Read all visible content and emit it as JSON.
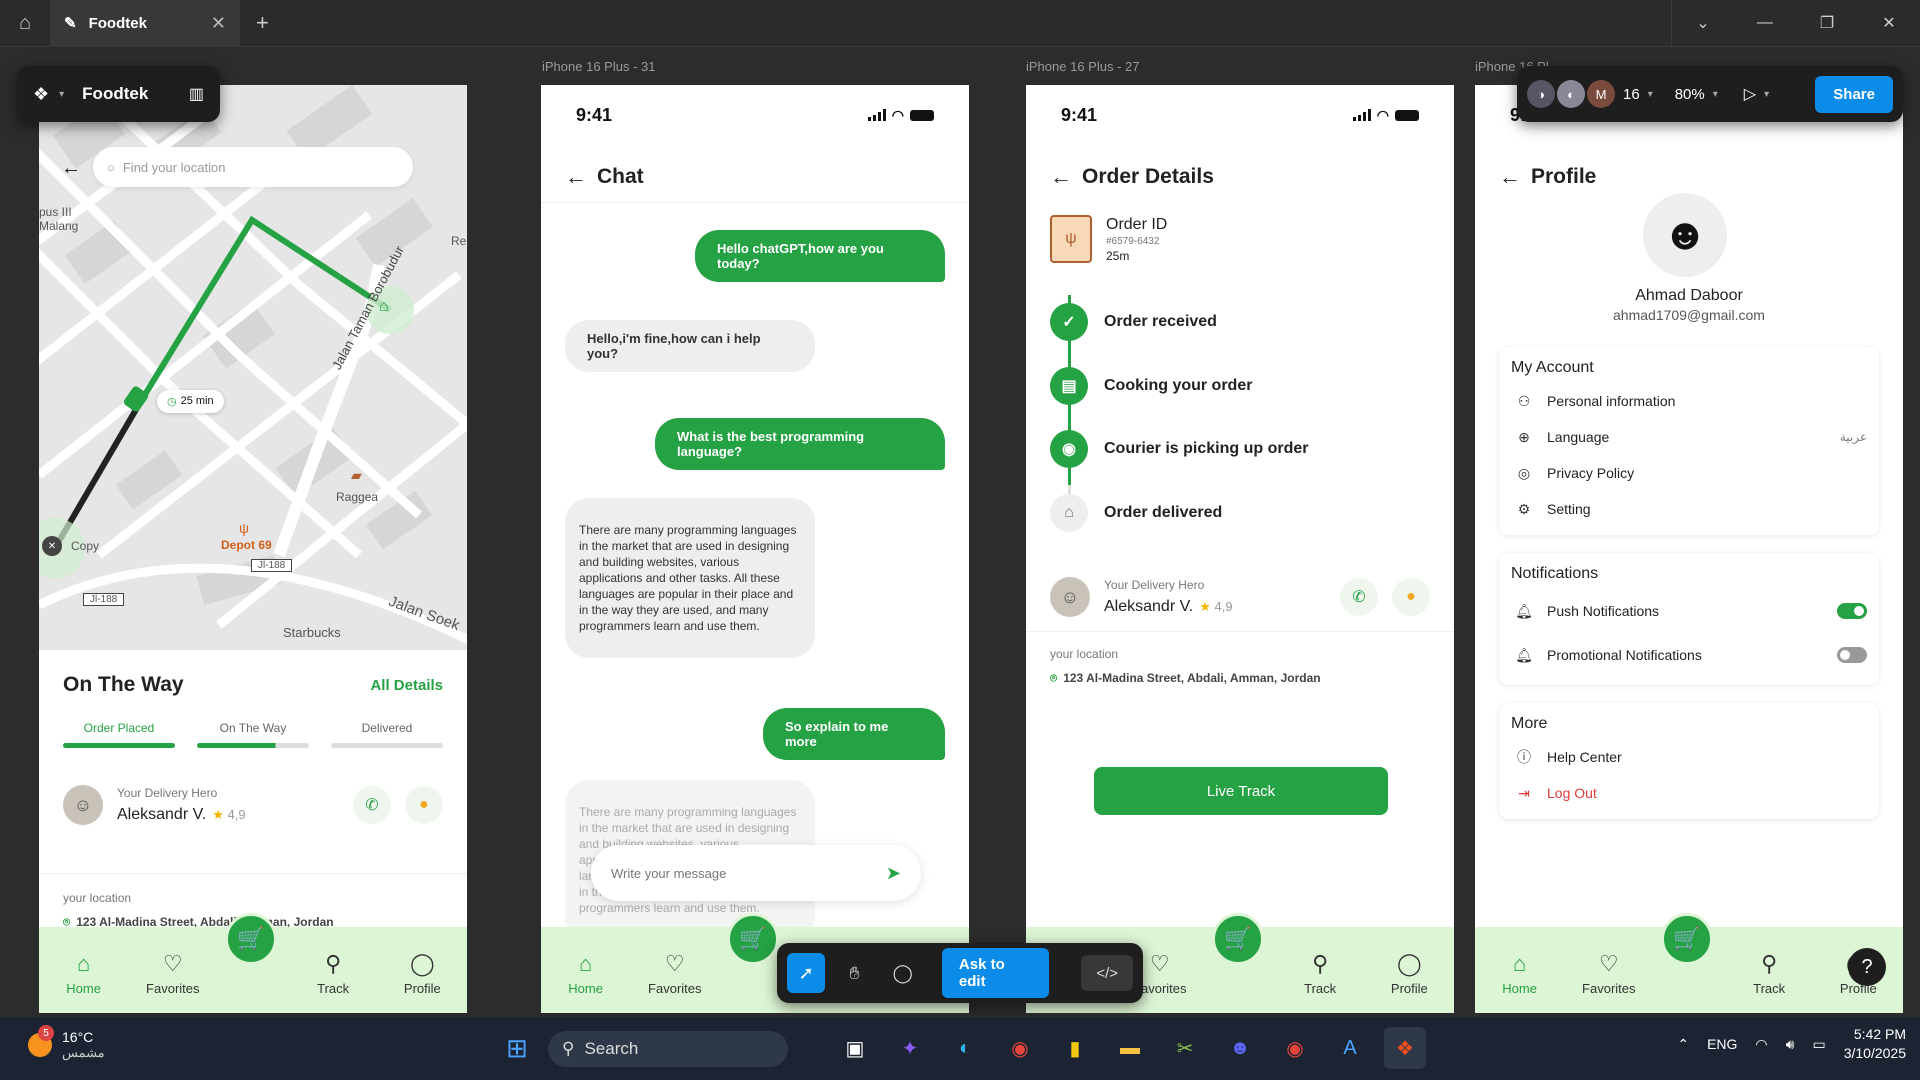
{
  "titlebar": {
    "tab_title": "Foodtek"
  },
  "figma": {
    "file_name": "Foodtek",
    "collaborator_initial": "M",
    "collaborator_count": "16",
    "zoom": "80%",
    "share_label": "Share",
    "ask_label": "Ask to edit",
    "help_label": "?"
  },
  "frames": {
    "f1": "iPhone 16 Plus - 31",
    "f2": "iPhone 16 Plus - 27",
    "f3": "iPhone 16 Pl"
  },
  "status_time": "9:41",
  "nav": {
    "home": "Home",
    "favorites": "Favorites",
    "track": "Track",
    "profile": "Profile"
  },
  "track_screen": {
    "search_placeholder": "Find your location",
    "map_labels": {
      "malang": "pus III\nMalang",
      "re": "Re",
      "eta": "25 min",
      "street": "Jalan Taman Borobudur",
      "raggea": "Raggea",
      "copy": "Copy",
      "depot": "Depot 69",
      "jl1": "Jl-188",
      "jl2": "Jl-188",
      "starbucks": "Starbucks",
      "soek": "Jalan Soek"
    },
    "title": "On The Way",
    "all_details": "All Details",
    "steps": [
      "Order Placed",
      "On The Way",
      "Delivered"
    ],
    "hero_label": "Your Delivery Hero",
    "hero_name": "Aleksandr V.",
    "rating": "4,9",
    "location_label": "your location",
    "address": "123 Al-Madina Street, Abdali, Amman, Jordan"
  },
  "chat_screen": {
    "title": "Chat",
    "messages": [
      "Hello chatGPT,how are you today?",
      "Hello,i'm fine,how can i help you?",
      "What is the best programming language?",
      "There are many programming languages in the market that are used in designing and building websites, various applications and other tasks. All these languages are popular in their place and in the way they are used, and many programmers learn and use them.",
      "So explain to me more",
      "There are many programming languages in the market that are used in designing and building websites, various applications and other tasks. All these languages are popular in their place and in the way they are used, and many programmers learn and use them."
    ],
    "input_placeholder": "Write your message"
  },
  "order_screen": {
    "title": "Order Details",
    "order_id_label": "Order ID",
    "order_id": "#6579-6432",
    "order_time": "25m",
    "steps": [
      "Order received",
      "Cooking your order",
      "Courier is picking up order",
      "Order delivered"
    ],
    "hero_label": "Your Delivery Hero",
    "hero_name": "Aleksandr V.",
    "rating": "4,9",
    "location_label": "your location",
    "address": "123 Al-Madina Street, Abdali, Amman, Jordan",
    "live_track": "Live Track"
  },
  "profile_screen": {
    "title": "Profile",
    "name": "Ahmad Daboor",
    "email": "ahmad1709@gmail.com",
    "account_title": "My Account",
    "account_items": [
      "Personal information",
      "Language",
      "Privacy Policy",
      "Setting"
    ],
    "language_value": "عربية",
    "notif_title": "Notifications",
    "notif_items": [
      "Push Notifications",
      "Promotional Notifications"
    ],
    "more_title": "More",
    "more_items": [
      "Help Center",
      "Log Out"
    ]
  },
  "taskbar": {
    "weather_badge": "5",
    "temp": "16°C",
    "condition": "مشمس",
    "search": "Search",
    "lang": "ENG",
    "time": "5:42 PM",
    "date": "3/10/2025"
  },
  "colors": {
    "accent": "#25a244",
    "nav_bg": "#dcf5d4",
    "figma_blue": "#0c8ce9"
  }
}
